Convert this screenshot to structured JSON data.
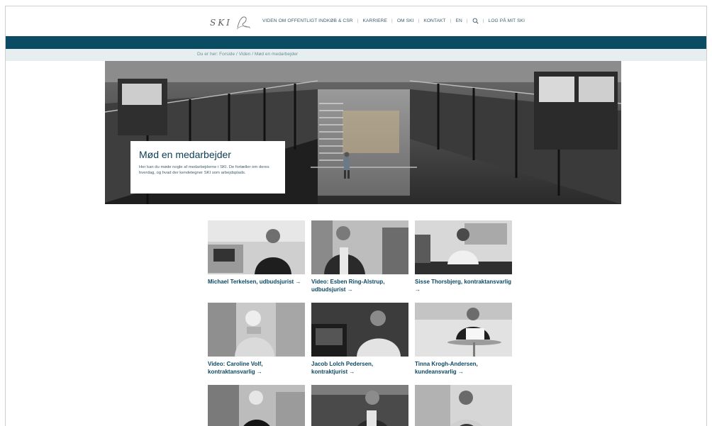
{
  "header": {
    "logo_text": "SKI",
    "nav": [
      {
        "label": "VIDEN OM OFFENTLIGT INDKØB & CSR"
      },
      {
        "label": "KARRIERE"
      },
      {
        "label": "OM SKI"
      },
      {
        "label": "KONTAKT"
      },
      {
        "label": "EN"
      },
      {
        "label": "LOG PÅ MIT SKI"
      }
    ]
  },
  "breadcrumb": "Du er her: Forside / Viden / Mød en medarbejder",
  "hero": {
    "title": "Mød en medarbejder",
    "description": "Her kan du møde nogle af medarbejderne i SKI. De fortæller om deres hverdag, og hvad der kendetegner SKI som arbejdsplads."
  },
  "employees": [
    {
      "label": "Michael Terkelsen, udbudsjurist →"
    },
    {
      "label": "Video: Esben Ring-Alstrup, udbudsjurist →"
    },
    {
      "label": "Sisse Thorsbjerg, kontraktansvarlig →"
    },
    {
      "label": "Video: Caroline Volf, kontraktansvarlig →"
    },
    {
      "label": "Jacob Lolch Pedersen, kontraktjurist →"
    },
    {
      "label": "Tinna Krogh-Andersen, kundeansvarlig →"
    },
    {
      "label": ""
    },
    {
      "label": ""
    },
    {
      "label": ""
    }
  ],
  "colors": {
    "brand_dark_blue": "#0b4b63",
    "breadcrumb_bg": "#e6eef0",
    "link_text": "#0d4a64"
  },
  "icons": {
    "search": "search-icon",
    "logo": "ski-logo-icon"
  }
}
